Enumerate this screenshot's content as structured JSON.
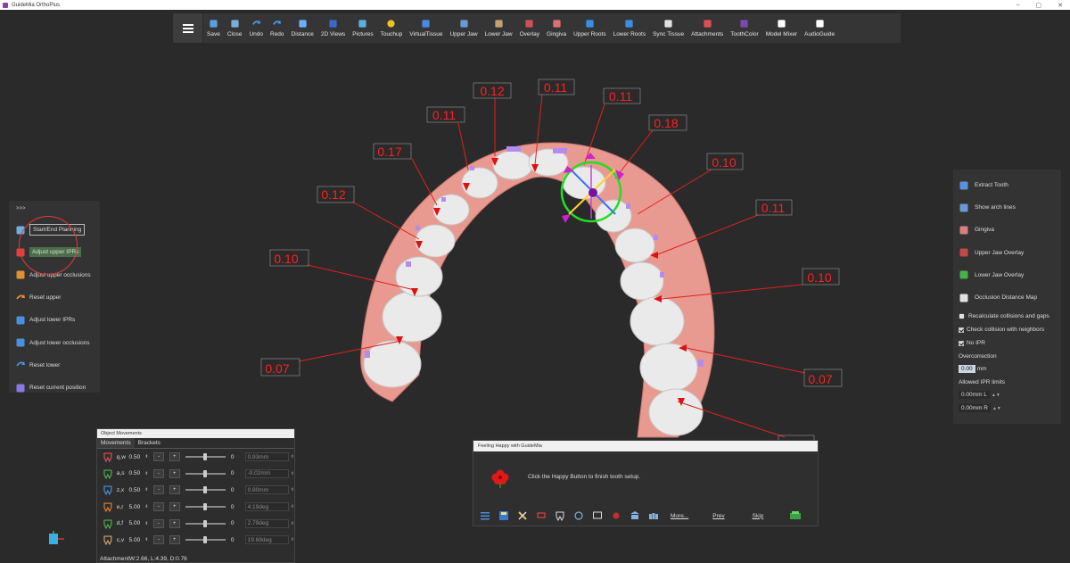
{
  "window": {
    "title": "GuideMia OrthoPlus"
  },
  "toolbar": {
    "tools": [
      {
        "label": "Save",
        "icon": "save-icon",
        "color": "#5aa0e0"
      },
      {
        "label": "Close",
        "icon": "close-icon",
        "color": "#7aaee0"
      },
      {
        "label": "Undo",
        "icon": "undo-icon",
        "color": "#4a9ff0"
      },
      {
        "label": "Redo",
        "icon": "redo-icon",
        "color": "#4a9ff0"
      },
      {
        "label": "Distance",
        "icon": "distance-icon",
        "color": "#6ab0ff"
      },
      {
        "label": "2D Views",
        "icon": "2d-views-icon",
        "color": "#3a6ac8"
      },
      {
        "label": "Pictures",
        "icon": "pictures-icon",
        "color": "#5ab0e0"
      },
      {
        "label": "Touchup",
        "icon": "touchup-icon",
        "color": "#f0c020"
      },
      {
        "label": "VirtualTissue",
        "icon": "virtual-tissue-icon",
        "color": "#4a8ae0"
      },
      {
        "label": "Upper Jaw",
        "icon": "upper-jaw-icon",
        "color": "#6a9ad0"
      },
      {
        "label": "Lower Jaw",
        "icon": "lower-jaw-icon",
        "color": "#c8a070"
      },
      {
        "label": "Overlay",
        "icon": "overlay-icon",
        "color": "#d05050"
      },
      {
        "label": "Gingiva",
        "icon": "gingiva-icon",
        "color": "#e07070"
      },
      {
        "label": "Upper Roots",
        "icon": "upper-roots-icon",
        "color": "#3a90e0"
      },
      {
        "label": "Lower Roots",
        "icon": "lower-roots-icon",
        "color": "#3a90e0"
      },
      {
        "label": "Sync Tissue",
        "icon": "sync-tissue-icon",
        "color": "#e0e0e0"
      },
      {
        "label": "Attachments",
        "icon": "attachments-icon",
        "color": "#e05050"
      },
      {
        "label": "ToothColor",
        "icon": "tooth-color-icon",
        "color": "#7a4ab0"
      },
      {
        "label": "Model Mixer",
        "icon": "model-mixer-icon",
        "color": "#ffffff"
      },
      {
        "label": "AudioGuide",
        "icon": "audio-guide-icon",
        "color": "#ffffff"
      }
    ]
  },
  "left_panel": {
    "toggle": ">>>",
    "items": [
      {
        "label": "Start/End Planning",
        "icon": "planning-icon",
        "color": "#6ab0e0"
      },
      {
        "label": "Adjust upper IPRs",
        "icon": "adjust-upper-iprs-icon",
        "color": "#e04040"
      },
      {
        "label": "Adjust upper occlusions",
        "icon": "adjust-upper-occlusions-icon",
        "color": "#e09030"
      },
      {
        "label": "Reset upper",
        "icon": "reset-upper-icon",
        "color": "#e09030"
      },
      {
        "label": "Adjust lower IPRs",
        "icon": "adjust-lower-iprs-icon",
        "color": "#4a90e0"
      },
      {
        "label": "Adjust lower occlusions",
        "icon": "adjust-lower-occlusions-icon",
        "color": "#4a90e0"
      },
      {
        "label": "Reset lower",
        "icon": "reset-lower-icon",
        "color": "#4a90e0"
      },
      {
        "label": "Reset current position",
        "icon": "reset-position-icon",
        "color": "#8a7ae0"
      }
    ]
  },
  "right_panel": {
    "items": [
      {
        "label": "Extract Tooth",
        "icon": "extract-tooth-icon",
        "color": "#5a90e0"
      },
      {
        "label": "Show arch lines",
        "icon": "arch-lines-icon",
        "color": "#6a9ad0"
      },
      {
        "label": "Gingiva",
        "icon": "gingiva-icon",
        "color": "#d88080"
      },
      {
        "label": "Upper Jaw Overlay",
        "icon": "upper-overlay-icon",
        "color": "#c04a4a"
      },
      {
        "label": "Lower Jaw Overlay",
        "icon": "lower-overlay-icon",
        "color": "#4ab04a"
      },
      {
        "label": "Occlusion Distance Map",
        "icon": "distance-map-icon",
        "color": "#e0e0e0"
      },
      {
        "label": "Recalculate collisions and gaps",
        "icon": "recalculate-icon",
        "color": "#e0e0e0"
      }
    ],
    "check_collision": "Check collision with neighbors",
    "no_ipr": "No IPR",
    "overcorrection_label": "Overcorrection",
    "overcorrection_value": "0.00",
    "overcorrection_unit": "mm",
    "ipr_limits_label": "Allowed IPR limits",
    "ipr_limit_l": "0.00mm L",
    "ipr_limit_r": "0.00mm R"
  },
  "object_movements": {
    "title": "Object Movements",
    "tabs": [
      "Movements",
      "Brackets"
    ],
    "rows": [
      {
        "axis": "q,w",
        "value": "0.50",
        "zero": "0",
        "measure": "0.93mm",
        "color": "#e05050"
      },
      {
        "axis": "a,s",
        "value": "0.50",
        "zero": "0",
        "measure": "-0.02mm",
        "color": "#4ab04a"
      },
      {
        "axis": "z,x",
        "value": "0.50",
        "zero": "0",
        "measure": "0.80mm",
        "color": "#4a90e0"
      },
      {
        "axis": "e,r",
        "value": "5.00",
        "zero": "0",
        "measure": "4.19deg",
        "color": "#e08030"
      },
      {
        "axis": "d,f",
        "value": "5.00",
        "zero": "0",
        "measure": "2.79deg",
        "color": "#4ab04a"
      },
      {
        "axis": "c,v",
        "value": "5.00",
        "zero": "0",
        "measure": "19.69deg",
        "color": "#d0a070"
      }
    ],
    "footer": "AttachmentW:2.66, L:4.39, D:0.76"
  },
  "happy_dialog": {
    "title": "Feeling Happy with GuideMia",
    "message": "Click the Happy Button to finish tooth setup.",
    "more": "More...",
    "prev": "Prev",
    "skip": "Skip"
  },
  "ipr_values": [
    {
      "text": "0.12"
    },
    {
      "text": "0.11"
    },
    {
      "text": "0.11"
    },
    {
      "text": "0.11"
    },
    {
      "text": "0.18"
    },
    {
      "text": "0.17"
    },
    {
      "text": "0.10"
    },
    {
      "text": "0.12"
    },
    {
      "text": "0.11"
    },
    {
      "text": "0.10"
    },
    {
      "text": "0.10"
    },
    {
      "text": "0.07"
    },
    {
      "text": "0.07"
    }
  ]
}
